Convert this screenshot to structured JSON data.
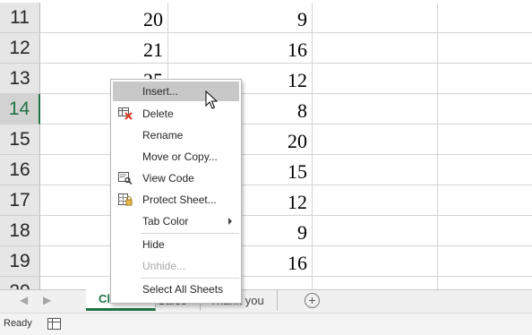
{
  "rows": [
    {
      "num": "11",
      "b": "20",
      "c": "9"
    },
    {
      "num": "12",
      "b": "21",
      "c": "16"
    },
    {
      "num": "13",
      "b": "25",
      "c": "12"
    },
    {
      "num": "14",
      "b": "",
      "c": "8"
    },
    {
      "num": "15",
      "b": "",
      "c": "20"
    },
    {
      "num": "16",
      "b": "",
      "c": "15"
    },
    {
      "num": "17",
      "b": "",
      "c": "12"
    },
    {
      "num": "18",
      "b": "",
      "c": "9"
    },
    {
      "num": "19",
      "b": "",
      "c": "16"
    },
    {
      "num": "20",
      "b": "",
      "c": ""
    }
  ],
  "context_menu": {
    "items": [
      {
        "label": "Insert...",
        "icon": "none"
      },
      {
        "label": "Delete",
        "icon": "delete-sheet-icon"
      },
      {
        "label": "Rename",
        "icon": "none"
      },
      {
        "label": "Move or Copy...",
        "icon": "none"
      },
      {
        "label": "View Code",
        "icon": "view-code-icon"
      },
      {
        "label": "Protect Sheet...",
        "icon": "protect-sheet-icon"
      },
      {
        "label": "Tab Color",
        "icon": "none"
      },
      {
        "label": "Hide",
        "icon": "none"
      },
      {
        "label": "Unhide...",
        "icon": "none"
      },
      {
        "label": "Select All Sheets",
        "icon": "none"
      }
    ]
  },
  "sheet_tabs": [
    {
      "label": "Classes",
      "active": true
    },
    {
      "label": "Sales",
      "active": false
    },
    {
      "label": "Thank you",
      "active": false
    }
  ],
  "status": {
    "ready": "Ready"
  },
  "colors": {
    "accent": "#217346",
    "menu_hover": "#c8c8c8",
    "delete_red": "#d9381e"
  }
}
